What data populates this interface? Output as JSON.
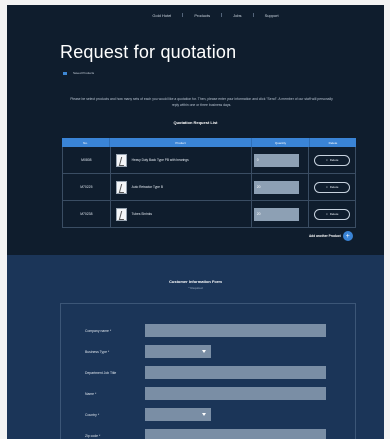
{
  "nav": {
    "items": [
      "Gold Hotel",
      "Products",
      "Jobs",
      "Support"
    ]
  },
  "page_title": "Request for quotation",
  "breadcrumb": {
    "current": "Saved Products"
  },
  "intro": "Please be select products and how many sets of each you would like a quotation for. Then, please enter your information and click \"Send\". A member of our staff will personally reply within one or three business days.",
  "list_title": "Quotation Request List",
  "table": {
    "headers": [
      "No.",
      "Product",
      "Quantity",
      "Delete"
    ],
    "rows": [
      {
        "no": "M0808",
        "product": "Heavy Duty Back Type PB with bearings",
        "qty": "0",
        "delete": "Delete"
      },
      {
        "no": "M70225",
        "product": "Auto Retractor Type B",
        "qty": "20",
        "delete": "Delete"
      },
      {
        "no": "M70238",
        "product": "Tubes Shrinks",
        "qty": "20",
        "delete": "Delete"
      }
    ]
  },
  "add_more": "Add another Product",
  "form": {
    "title": "Customer Information Form",
    "subtitle": "* Required",
    "fields": [
      {
        "label": "Company name *",
        "type": "text"
      },
      {
        "label": "Business Type *",
        "type": "select"
      },
      {
        "label": "Department Job Title",
        "type": "text"
      },
      {
        "label": "Name *",
        "type": "text"
      },
      {
        "label": "Country *",
        "type": "select"
      },
      {
        "label": "Zip code *",
        "type": "text"
      }
    ]
  },
  "colors": {
    "background": "#0f1d2d",
    "accent": "#3a84d6",
    "form_section": "#1b3558"
  }
}
